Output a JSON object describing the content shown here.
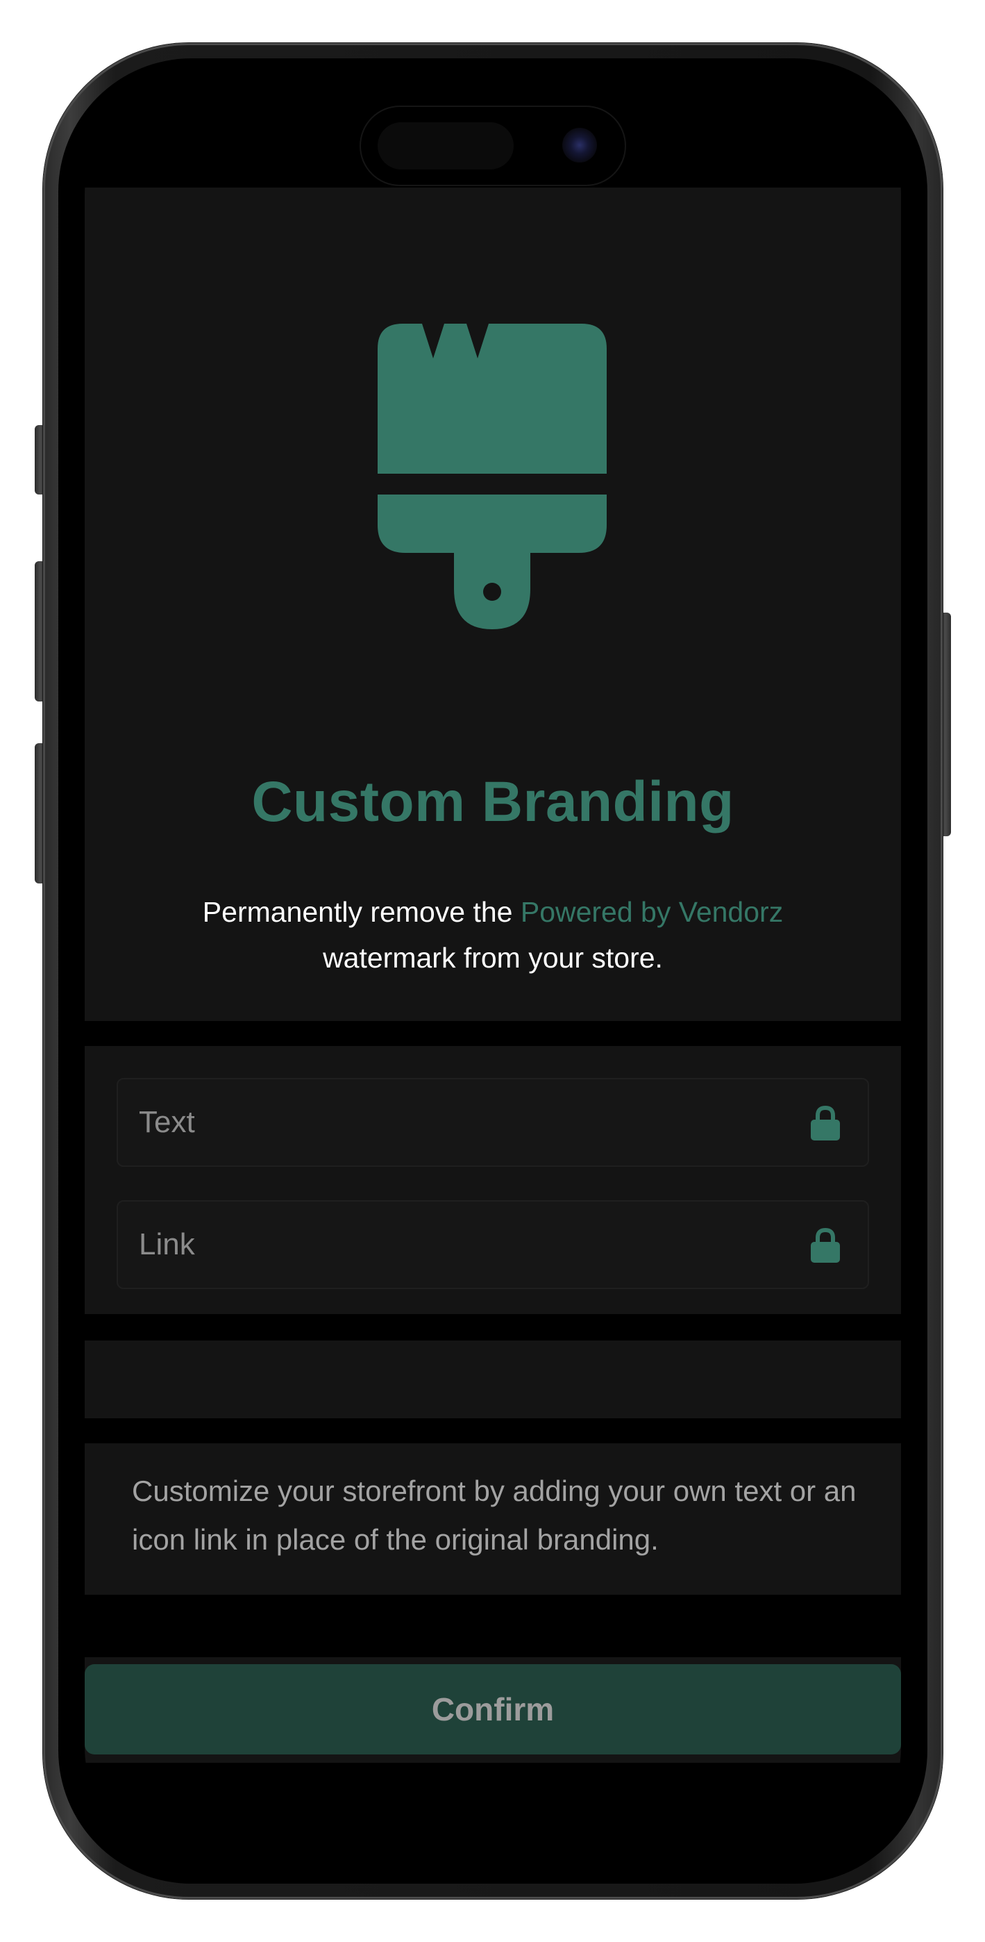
{
  "feature": {
    "title": "Custom Branding",
    "description_before": "Permanently remove the ",
    "description_highlight": "Powered by Vendorz",
    "description_after": "watermark from your store."
  },
  "fields": {
    "text_placeholder": "Text",
    "link_placeholder": "Link"
  },
  "info": {
    "text": "Customize your storefront by adding your own text or an icon link in place of the original branding."
  },
  "actions": {
    "confirm_label": "Confirm"
  },
  "icons": {
    "hero": "paintbrush-icon",
    "field_lock": "lock-icon"
  },
  "colors": {
    "accent": "#357766",
    "confirm_bg": "#1f4239",
    "card_bg": "#141414",
    "page_bg": "#000000"
  }
}
